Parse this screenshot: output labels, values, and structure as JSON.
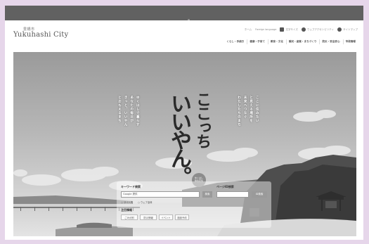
{
  "site": {
    "logo_jp": "豊橋市",
    "logo_en": "Yukuhashi City"
  },
  "utility": {
    "links": [
      "ホーム",
      "Foreign language"
    ],
    "icon_links": [
      {
        "icon": "accessibility-icon",
        "label": "文字サイズ"
      },
      {
        "icon": "globe-icon",
        "label": "ウェブアクセシビリティ"
      },
      {
        "icon": "sitemap-icon",
        "label": "サイトマップ"
      }
    ]
  },
  "global_nav": [
    "くらし・手続き",
    "健康・子育て",
    "教育・文化",
    "観光・産業・まちづくり",
    "防災・安全安心",
    "市政情報"
  ],
  "hero": {
    "catch_line1": "ここっち",
    "catch_line2": "いいやん。",
    "badge_line1": "ゆくはし",
    "badge_line2": "移住定住",
    "copy_left": [
      "ゆくはしで暮らす",
      "あなたの毎日が",
      "きっと、いいやん",
      "とおもえるまち"
    ],
    "copy_right": [
      "ここに住みたい",
      "と思える場所を",
      "未来へつなぐ",
      "わたしたちのまち"
    ]
  },
  "search": {
    "keyword_label": "キーワード検索",
    "keyword_placeholder": "Google 提供",
    "keyword_button": "検索",
    "page_label": "ページID検索",
    "page_button": "ID検索",
    "radio_site": "サイト内",
    "radio_web": "ウェブ全体",
    "popular_label": "注目情報",
    "tags": [
      "ごみ分別",
      "防災情報",
      "イベント",
      "施設予約"
    ]
  },
  "colors": {
    "topbar": "#616161",
    "background": "#e6d6ea"
  }
}
